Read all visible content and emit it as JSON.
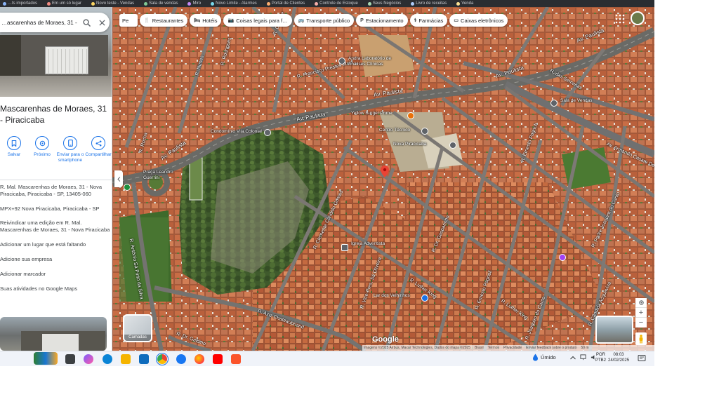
{
  "browser_bookmarks": [
    "…ts importados",
    "Em um só lugar",
    "Novo teste - Vendas",
    "Sala de vendas",
    "Miro",
    "Novo Limite - Alarmes",
    "Portal de Clientes",
    "Controle de Estoque",
    "Seus Negócios",
    "Livro de receitas",
    "Venda"
  ],
  "search": {
    "query": "…ascarenhas de Moraes, 31 -"
  },
  "place": {
    "title": "Mascarenhas de Moraes, 31 - Piracicaba"
  },
  "actions": [
    {
      "label": "Salvar",
      "icon": "bookmark-icon"
    },
    {
      "label": "Próximo",
      "icon": "nearby-icon"
    },
    {
      "label": "Enviar para o smartphone",
      "icon": "send-phone-icon"
    },
    {
      "label": "Compartilhar",
      "icon": "share-icon"
    }
  ],
  "info": [
    "R. Mal. Mascarenhas de Moraes, 31 - Nova Piracicaba, Piracicaba - SP, 13405-060",
    "MPX+92 Nova Piracicaba, Piracicaba - SP",
    "Reivindicar uma edição em R. Mal. Mascarenhas de Moraes, 31 - Nova Piracicaba",
    "Adicionar um lugar que está faltando",
    "Adicione sua empresa",
    "Adicionar marcador",
    "Suas atividades no Google Maps"
  ],
  "chips": [
    {
      "label": "Pe",
      "icon": ""
    },
    {
      "label": "Restaurantes",
      "icon": "restaurant-icon"
    },
    {
      "label": "Hotéis",
      "icon": "hotel-icon"
    },
    {
      "label": "Coisas legais para f…",
      "icon": "camera-icon"
    },
    {
      "label": "Transporte público",
      "icon": "bus-icon"
    },
    {
      "label": "Estacionamento",
      "icon": "parking-icon"
    },
    {
      "label": "Farmácias",
      "icon": "pharmacy-icon"
    },
    {
      "label": "Caixas eletrônicos",
      "icon": "atm-icon"
    }
  ],
  "layers_label": "Camadas",
  "map_labels": {
    "av_paulista_1": "Av. Paulista",
    "av_paulista_2": "Av. Paulista",
    "av_paulista_3": "Av. Paulista",
    "av_paulista_4": "Av. Paulista",
    "av_paulista_5": "Av. Paulista",
    "r_francisco": "R. Francisco Prestes Maia",
    "r_das_semanas": "R. das Semanas",
    "av_armando": "Av. Armando Cesare Dedini",
    "r_clemente": "R. Clemente Cândido Gomes",
    "r_aziz": "R. Aziz Chateaubriand",
    "r_luther": "R. Luther King",
    "r_luther2": "R. Luther King",
    "r_ernesto": "R. Ernesto Pagnoli",
    "r_joao": "R. Padre Joaquim do Canto",
    "r_gasp": "R. Dr. Gasparinho",
    "r_joaquim": "R. Joaquim do Canto",
    "r_antonio": "R. Antônio Sá Pinto da Silva",
    "r_rocha": "R. Rocha",
    "r_ernesto2": "R. Ernesto Pagnoli",
    "r_vice": "R. Vice-Pres. Sá Oliveira",
    "r_leite": "R. Dr. Leite",
    "r_gualdino": "R. Dr. Galdino",
    "r_castro": "R. Cândida Acquaviva",
    "r_nunes": "R. Nunes",
    "r_rodrigues": "R. Rodrigues",
    "praca": "Praça Leandro Guerrini"
  },
  "pois": [
    {
      "text": "Andra Laboratório de Análises Clínicas",
      "color": "#5f6368"
    },
    {
      "text": "Yellow Burger Prime",
      "color": "#e8710a"
    },
    {
      "text": "Condomínio Vila Colonial",
      "color": "#5f6368"
    },
    {
      "text": "Centro Técnico",
      "color": "#5f6368"
    },
    {
      "text": "Nova Piracicaba",
      "color": "#5f6368"
    },
    {
      "text": "Sala de Vendas",
      "color": "#5f6368"
    },
    {
      "text": "Igreja Adventista",
      "color": "#5f6368"
    },
    {
      "text": "Lar dos Velhinhos",
      "color": "#1a73e8"
    }
  ],
  "google_logo": "Google",
  "attribution": [
    "Imagens ©2025 Airbus, Maxar Technologies, Dados do mapa ©2025",
    "Brasil",
    "Termos",
    "Privacidade",
    "Enviar feedback sobre o produto",
    "50 m"
  ],
  "taskbar": {
    "weather": "Úmido",
    "lang": [
      "POR",
      "PTB2"
    ],
    "time": "08:03",
    "date": "24/02/2025"
  },
  "colors": {
    "accent": "#1a73e8",
    "pin": "#ea4335"
  }
}
